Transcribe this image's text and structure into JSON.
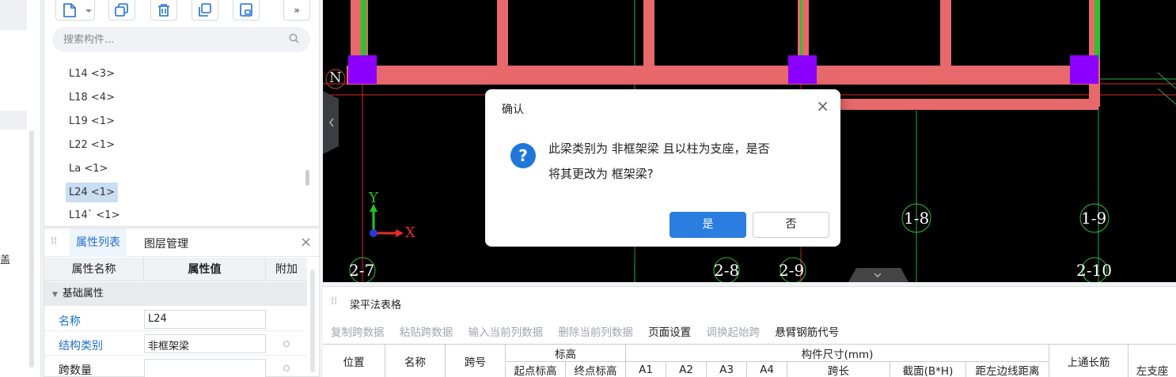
{
  "left_strip": {
    "label": "盖"
  },
  "toolbar": {
    "icons": [
      "new-component-icon",
      "dropdown-arrow-icon",
      "copy-icon",
      "delete-icon",
      "copy-layer-icon",
      "save-to-icon",
      "more-icon"
    ],
    "more_label": "»"
  },
  "search": {
    "placeholder": "搜索构件..."
  },
  "components": [
    "L14 <3>",
    "L18 <4>",
    "L19 <1>",
    "L22 <1>",
    "La <1>",
    "L24 <1>",
    "L14` <1>"
  ],
  "selected_component": "L24 <1>",
  "prop_panel": {
    "tabs": [
      "属性列表",
      "图层管理"
    ],
    "active_tab": "属性列表",
    "close": "×",
    "columns": [
      "属性名称",
      "属性值",
      "附加"
    ],
    "group": "基础属性",
    "rows": [
      {
        "name": "名称",
        "value": "L24"
      },
      {
        "name": "结构类别",
        "value": "非框架梁"
      },
      {
        "name": "跨数量",
        "value": ""
      }
    ]
  },
  "cad": {
    "axis_labels": [
      "2-7",
      "2-8",
      "2-9",
      "2-10",
      "1-8",
      "1-9"
    ],
    "coord_x": "X",
    "coord_y": "Y",
    "n_label": "N",
    "beam_color": "#e8696b",
    "column_color": "#8b00ff",
    "green_color": "#33cc33",
    "grid_color": "#e31b1b"
  },
  "dialog": {
    "title": "确认",
    "line1": "此梁类别为 非框架梁 且以柱为支座，是否",
    "line2": "将其更改为 框架梁?",
    "yes": "是",
    "no": "否",
    "close": "×"
  },
  "table_panel": {
    "title": "梁平法表格",
    "toolbar": [
      {
        "label": "复制跨数据",
        "enabled": false
      },
      {
        "label": "粘贴跨数据",
        "enabled": false
      },
      {
        "label": "输入当前列数据",
        "enabled": false
      },
      {
        "label": "删除当前列数据",
        "enabled": false
      },
      {
        "label": "页面设置",
        "enabled": true
      },
      {
        "label": "调换起始跨",
        "enabled": false
      },
      {
        "label": "悬臂钢筋代号",
        "enabled": true
      }
    ],
    "headers": {
      "position": "位置",
      "name": "名称",
      "span_no": "跨号",
      "elevation": "标高",
      "start_elev": "起点标高",
      "end_elev": "终点标高",
      "size": "构件尺寸(mm)",
      "a1": "A1",
      "a2": "A2",
      "a3": "A3",
      "a4": "A4",
      "span_len": "跨长",
      "section": "截面(B*H)",
      "edge_dist": "距左边线距离",
      "top_bar": "上通长筋",
      "left_support": "左支座"
    }
  }
}
